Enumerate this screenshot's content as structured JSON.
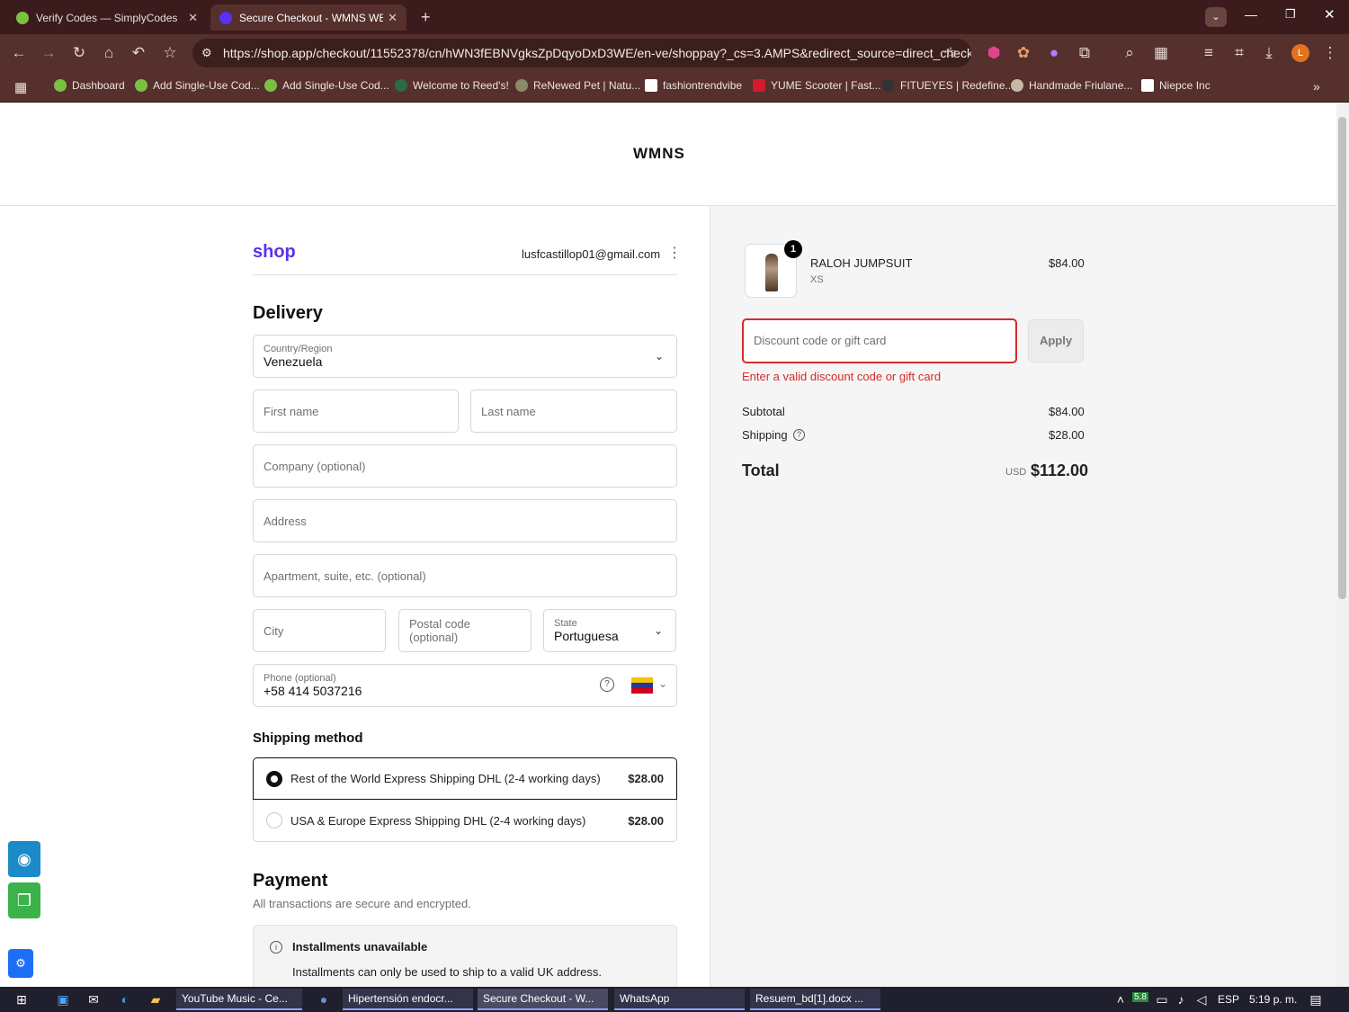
{
  "browser": {
    "tabs": [
      {
        "title": "Verify Codes — SimplyCodes",
        "active": false
      },
      {
        "title": "Secure Checkout - WMNS WEA",
        "active": true
      }
    ],
    "url": "https://shop.app/checkout/11552378/cn/hWN3fEBNVgksZpDqyoDxD3WE/en-ve/shoppay?_cs=3.AMPS&redirect_source=direct_check...",
    "bookmarks": [
      "Dashboard",
      "Add Single-Use Cod...",
      "Add Single-Use Cod...",
      "Welcome to Reed's!",
      "ReNewed Pet | Natu...",
      "fashiontrendvibe",
      "YUME Scooter | Fast...",
      "FITUEYES | Redefine...",
      "Handmade Friulane...",
      "Niepce Inc"
    ],
    "profile_initial": "L"
  },
  "store": {
    "logo": "WMNS"
  },
  "account": {
    "brand": "shop",
    "email": "lusfcastillop01@gmail.com"
  },
  "delivery": {
    "heading": "Delivery",
    "country_label": "Country/Region",
    "country_value": "Venezuela",
    "first_name": "First name",
    "last_name": "Last name",
    "company": "Company (optional)",
    "address": "Address",
    "apartment": "Apartment, suite, etc. (optional)",
    "city": "City",
    "postal": "Postal code (optional)",
    "state_label": "State",
    "state_value": "Portuguesa",
    "phone_label": "Phone (optional)",
    "phone_value": "+58 414 5037216"
  },
  "shipping_method": {
    "heading": "Shipping method",
    "options": [
      {
        "label": "Rest of the World Express Shipping DHL (2-4 working days)",
        "price": "$28.00",
        "selected": true
      },
      {
        "label": "USA & Europe Express Shipping DHL (2-4 working days)",
        "price": "$28.00",
        "selected": false
      }
    ]
  },
  "payment": {
    "heading": "Payment",
    "subtitle": "All transactions are secure and encrypted.",
    "notice_title": "Installments unavailable",
    "notice_text": "Installments can only be used to ship to a valid UK address."
  },
  "order": {
    "item_name": "RALOH JUMPSUIT",
    "item_variant": "XS",
    "item_qty": "1",
    "item_price": "$84.00",
    "discount_placeholder": "Discount code or gift card",
    "apply_label": "Apply",
    "error": "Enter a valid discount code or gift card",
    "subtotal_label": "Subtotal",
    "subtotal": "$84.00",
    "shipping_label": "Shipping",
    "shipping": "$28.00",
    "total_label": "Total",
    "currency": "USD",
    "total": "$112.00"
  },
  "taskbar": {
    "items": [
      "YouTube Music - Ce...",
      "Hipertensión endocr...",
      "Secure Checkout - W...",
      "WhatsApp",
      "Resuem_bd[1].docx ..."
    ],
    "lang": "ESP",
    "time": "5:19 p. m.",
    "badge": "5.8"
  },
  "colors": {
    "accent": "#5a31f4",
    "error": "#d42b2b",
    "chrome": "#55302c"
  }
}
